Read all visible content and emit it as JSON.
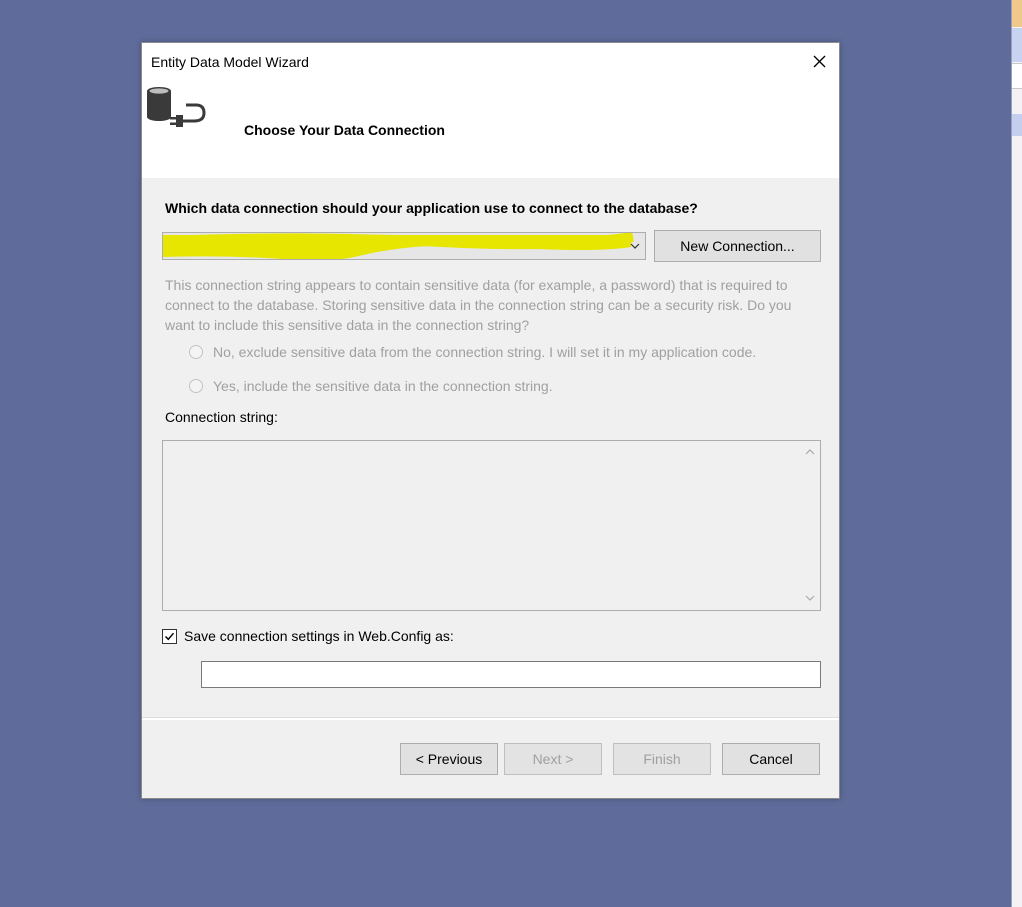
{
  "window": {
    "title": "Entity Data Model Wizard",
    "close_icon": "close-icon"
  },
  "header": {
    "step_title": "Choose Your Data Connection",
    "logo_icon": "database-plug-icon"
  },
  "main": {
    "question": "Which data connection should your application use to connect to the database?",
    "connection_combo_value": "",
    "new_connection_label": "New Connection...",
    "sensitive_info": "This connection string appears to contain sensitive data (for example, a password) that is required to connect to the database. Storing sensitive data in the connection string can be a security risk. Do you want to include this sensitive data in the connection string?",
    "radio_no_label": "No, exclude sensitive data from the connection string. I will set it in my application code.",
    "radio_yes_label": "Yes, include the sensitive data in the connection string.",
    "connection_string_label": "Connection string:",
    "connection_string_value": "",
    "save_settings_label": "Save connection settings in Web.Config as:",
    "save_settings_checked": true,
    "config_name_value": ""
  },
  "footer": {
    "previous_label": "< Previous",
    "next_label": "Next >",
    "finish_label": "Finish",
    "cancel_label": "Cancel"
  },
  "colors": {
    "desktop": "#5f6c9b",
    "dialog_body": "#f0f0f0",
    "highlight_marker": "#e6e600",
    "disabled_text": "#a0a0a0"
  }
}
